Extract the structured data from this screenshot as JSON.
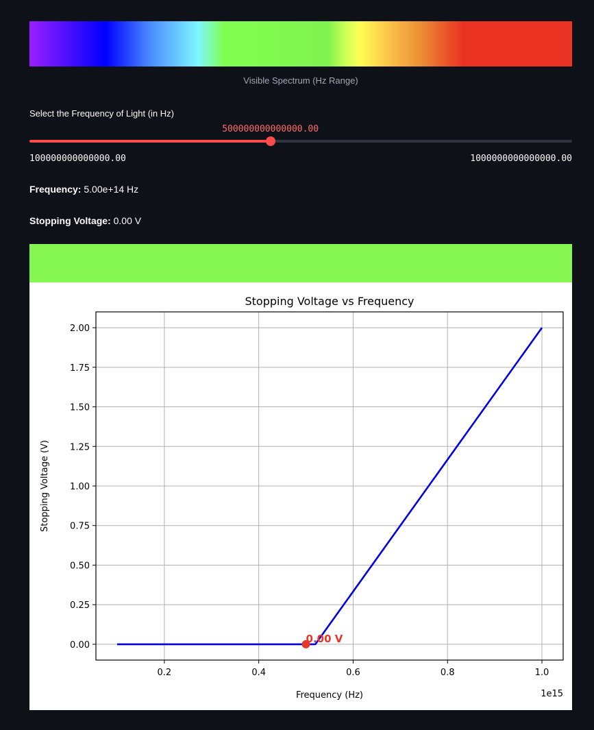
{
  "spectrum": {
    "caption": "Visible Spectrum (Hz Range)",
    "stops": [
      "#9b1fff",
      "#0000ff",
      "#4a88ff",
      "#7ff6ff",
      "#80ff4f",
      "#80f24f",
      "#c8ff55",
      "#ffff55",
      "#ffd04d",
      "#eb8f35",
      "#ea3222",
      "#ea3322"
    ]
  },
  "slider": {
    "label": "Select the Frequency of Light (in Hz)",
    "value": "500000000000000.00",
    "min": "100000000000000.00",
    "max": "1000000000000000.00",
    "fraction": 0.444,
    "accent": "#ff4b4b"
  },
  "stats": {
    "frequency_label": "Frequency:",
    "frequency_value": "5.00e+14 Hz",
    "voltage_label": "Stopping Voltage:",
    "voltage_value": "0.00 V"
  },
  "light_color": "#86f750",
  "chart_data": {
    "type": "line",
    "title": "Stopping Voltage vs Frequency",
    "xlabel": "Frequency (Hz)",
    "ylabel": "Stopping Voltage (V)",
    "x_offset_label": "1e15",
    "xlim": [
      0.055,
      1.045
    ],
    "ylim": [
      -0.1,
      2.1
    ],
    "xticks": [
      0.2,
      0.4,
      0.6,
      0.8,
      1.0
    ],
    "xtick_labels": [
      "0.2",
      "0.4",
      "0.6",
      "0.8",
      "1.0"
    ],
    "yticks": [
      0,
      0.25,
      0.5,
      0.75,
      1.0,
      1.25,
      1.5,
      1.75,
      2.0
    ],
    "ytick_labels": [
      "0.00",
      "0.25",
      "0.50",
      "0.75",
      "1.00",
      "1.25",
      "1.50",
      "1.75",
      "2.00"
    ],
    "grid": true,
    "series": [
      {
        "color": "#0000e6",
        "x": [
          0.1,
          0.5,
          0.52,
          1.0
        ],
        "y": [
          0,
          0,
          0,
          2.0
        ]
      }
    ],
    "marker": {
      "x": 0.5,
      "y": 0.0,
      "color": "#e8372a",
      "label": "0.00 V"
    }
  }
}
